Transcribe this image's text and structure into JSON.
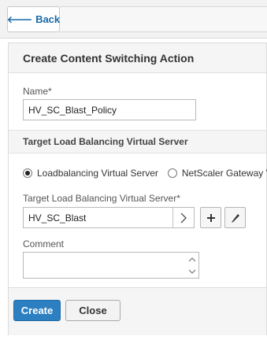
{
  "topbar": {
    "back_label": "Back"
  },
  "dialog": {
    "title": "Create Content Switching Action",
    "name_label": "Name*",
    "name_value": "HV_SC_Blast_Policy",
    "section_title": "Target Load Balancing Virtual Server",
    "radio_options": [
      {
        "label": "Loadbalancing Virtual Server",
        "checked": true
      },
      {
        "label": "NetScaler Gateway Virtual Server",
        "checked": false
      }
    ],
    "target_label": "Target Load Balancing Virtual Server*",
    "target_value": "HV_SC_Blast",
    "comment_label": "Comment",
    "comment_value": "",
    "create_label": "Create",
    "close_label": "Close"
  },
  "colors": {
    "primary": "#2c7fc0",
    "link": "#1a6aa8",
    "header_bg": "#f5f5f5"
  },
  "icons": {
    "back": "arrow-left-icon",
    "select": "chevron-right-icon",
    "add": "plus-icon",
    "edit": "pencil-icon",
    "scroll_up": "chevron-up-icon",
    "scroll_down": "chevron-down-icon"
  }
}
